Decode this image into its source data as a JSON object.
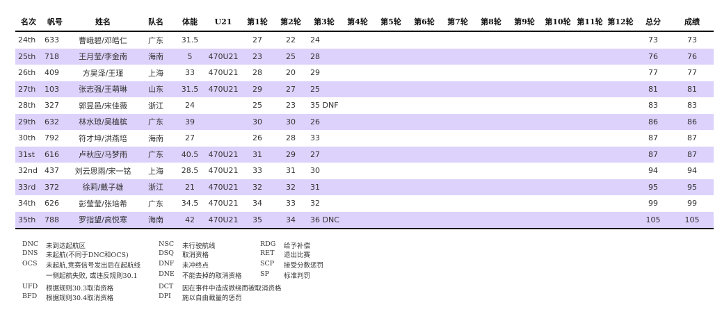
{
  "table": {
    "headers": [
      "名次",
      "帆号",
      "姓名",
      "队名",
      "体能",
      "U21",
      "第1轮",
      "第2轮",
      "第3轮",
      "第4轮",
      "第5轮",
      "第6轮",
      "第7轮",
      "第8轮",
      "第9轮",
      "第10轮",
      "第11轮",
      "第12轮",
      "总分",
      "成绩"
    ],
    "rows": [
      [
        "24th",
        "633",
        "曹峨碧/邓皓仁",
        "广东",
        "31.5",
        "",
        "27",
        "22",
        "24",
        "",
        "",
        "",
        "",
        "",
        "",
        "",
        "",
        "",
        "73",
        "73"
      ],
      [
        "25th",
        "718",
        "王月莹/李金南",
        "海南",
        "5",
        "470U21",
        "23",
        "25",
        "28",
        "",
        "",
        "",
        "",
        "",
        "",
        "",
        "",
        "",
        "76",
        "76"
      ],
      [
        "26th",
        "409",
        "方昊泽/王瑾",
        "上海",
        "33",
        "470U21",
        "28",
        "20",
        "29",
        "",
        "",
        "",
        "",
        "",
        "",
        "",
        "",
        "",
        "77",
        "77"
      ],
      [
        "27th",
        "103",
        "张志强/王萌琳",
        "山东",
        "31.5",
        "470U21",
        "29",
        "27",
        "25",
        "",
        "",
        "",
        "",
        "",
        "",
        "",
        "",
        "",
        "81",
        "81"
      ],
      [
        "28th",
        "327",
        "郭昱邑/宋佳薇",
        "浙江",
        "24",
        "",
        "25",
        "23",
        "35 DNF",
        "",
        "",
        "",
        "",
        "",
        "",
        "",
        "",
        "",
        "83",
        "83"
      ],
      [
        "29th",
        "632",
        "林水琼/吴植槟",
        "广东",
        "39",
        "",
        "30",
        "30",
        "26",
        "",
        "",
        "",
        "",
        "",
        "",
        "",
        "",
        "",
        "86",
        "86"
      ],
      [
        "30th",
        "792",
        "符才坤/洪燕培",
        "海南",
        "27",
        "",
        "26",
        "28",
        "33",
        "",
        "",
        "",
        "",
        "",
        "",
        "",
        "",
        "",
        "87",
        "87"
      ],
      [
        "31st",
        "616",
        "卢秋应/马梦雨",
        "广东",
        "40.5",
        "470U21",
        "31",
        "29",
        "27",
        "",
        "",
        "",
        "",
        "",
        "",
        "",
        "",
        "",
        "87",
        "87"
      ],
      [
        "32nd",
        "437",
        "刘云思雨/宋一铭",
        "上海",
        "28.5",
        "470U21",
        "33",
        "31",
        "30",
        "",
        "",
        "",
        "",
        "",
        "",
        "",
        "",
        "",
        "94",
        "94"
      ],
      [
        "33rd",
        "372",
        "徐莉/戴子雄",
        "浙江",
        "21",
        "470U21",
        "32",
        "32",
        "31",
        "",
        "",
        "",
        "",
        "",
        "",
        "",
        "",
        "",
        "95",
        "95"
      ],
      [
        "34th",
        "626",
        "彭莹莹/张培希",
        "广东",
        "34.5",
        "470U21",
        "34",
        "33",
        "32",
        "",
        "",
        "",
        "",
        "",
        "",
        "",
        "",
        "",
        "99",
        "99"
      ],
      [
        "35th",
        "788",
        "罗指望/高悦寒",
        "海南",
        "42",
        "470U21",
        "35",
        "34",
        "36 DNC",
        "",
        "",
        "",
        "",
        "",
        "",
        "",
        "",
        "",
        "105",
        "105"
      ]
    ]
  },
  "legend": {
    "col1": [
      {
        "code": "DNC",
        "desc": "未到达起航区"
      },
      {
        "code": "DNS",
        "desc": "未起航(不同于DNC和OCS)"
      },
      {
        "code": "OCS",
        "desc": "未起航,竞赛信号发出后在起航线"
      },
      {
        "code": "",
        "desc": "一侧起航失败, 或违反规则30.1"
      },
      {
        "code": "UFD",
        "desc": "根据规则30.3取消资格"
      },
      {
        "code": "BFD",
        "desc": "根据规则30.4取消资格"
      }
    ],
    "col2": [
      {
        "code": "NSC",
        "desc": "未行驶航线"
      },
      {
        "code": "DSQ",
        "desc": "取消资格"
      },
      {
        "code": "DNF",
        "desc": "未冲终点"
      },
      {
        "code": "DNE",
        "desc": "不能去掉的取消资格"
      },
      {
        "code": "DCT",
        "desc": "因在事件中造成掀绕而被取消资格"
      },
      {
        "code": "DPI",
        "desc": "施以自由裁量的惩罚"
      }
    ],
    "col3": [
      {
        "code": "RDG",
        "desc": "给予补偿"
      },
      {
        "code": "RET",
        "desc": "退出比赛"
      },
      {
        "code": "SCP",
        "desc": "接受分数惩罚"
      },
      {
        "code": "SP",
        "desc": "标准判罚"
      }
    ]
  }
}
